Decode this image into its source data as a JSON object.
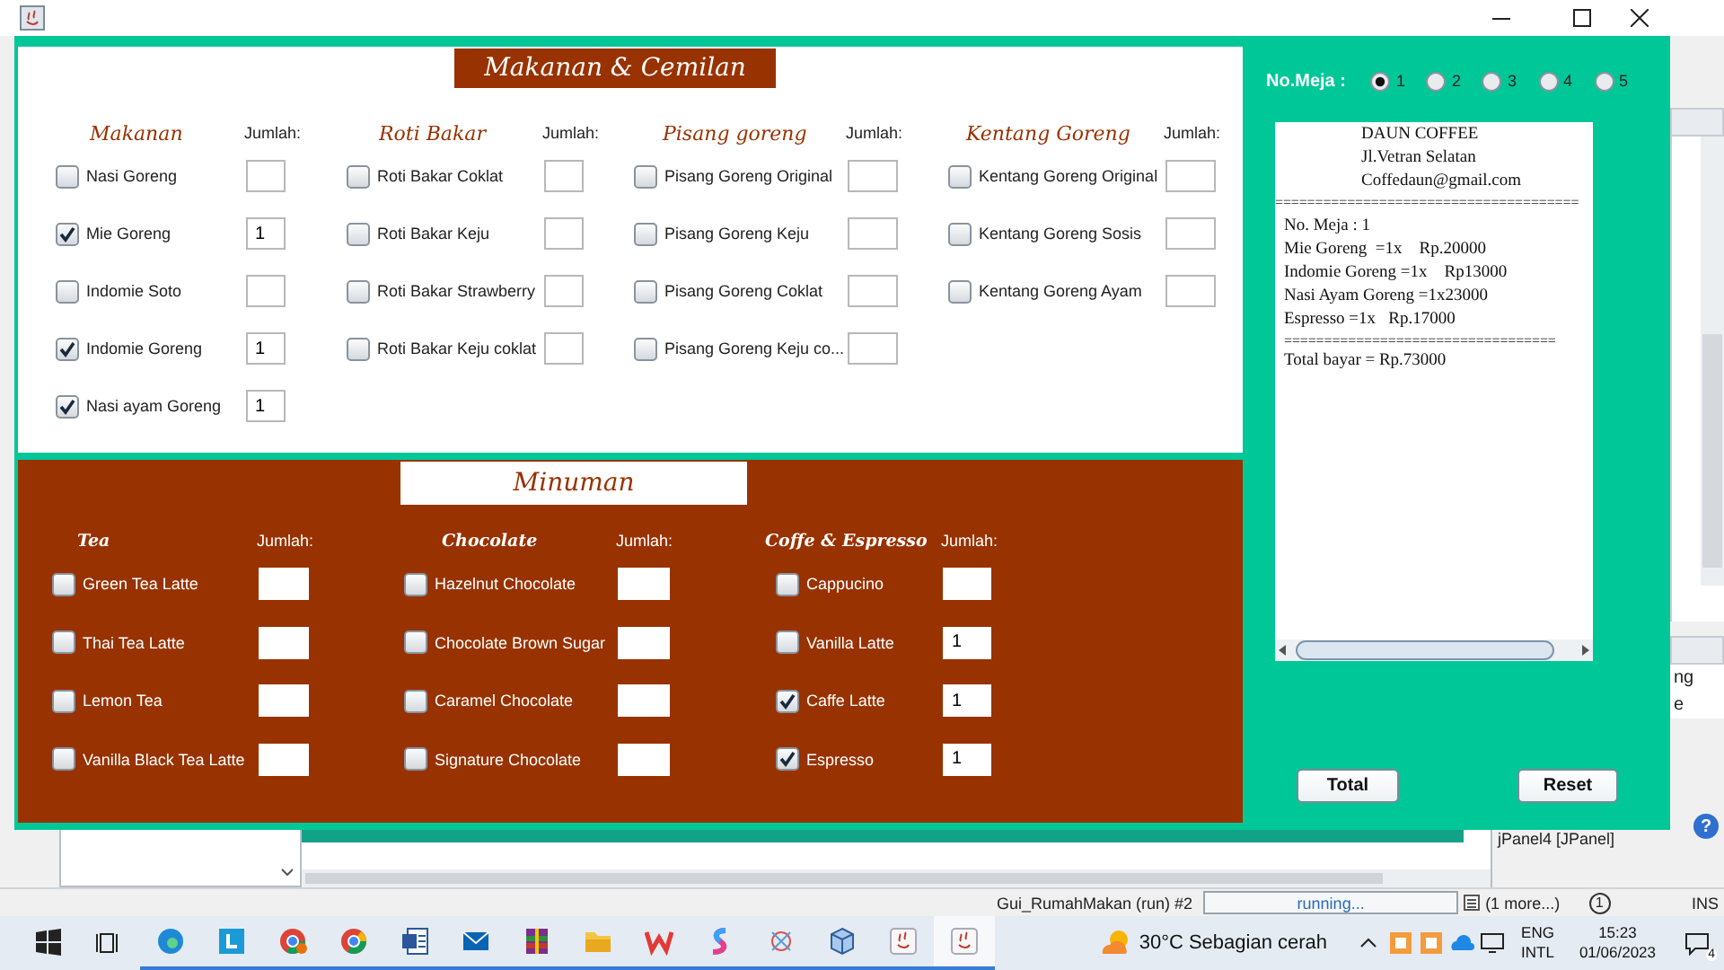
{
  "food_panel": {
    "title": "Makanan & Cemilan",
    "columns": [
      {
        "heading": "Makanan",
        "qty_label": "Jumlah:",
        "items": [
          {
            "label": "Nasi Goreng",
            "checked": false
          },
          {
            "label": "Mie Goreng",
            "checked": true,
            "qty": "1"
          },
          {
            "label": "Indomie Soto",
            "checked": false
          },
          {
            "label": "Indomie Goreng",
            "checked": true,
            "qty": "1"
          },
          {
            "label": "Nasi ayam Goreng",
            "checked": true,
            "qty": "1"
          }
        ]
      },
      {
        "heading": "Roti Bakar",
        "qty_label": "Jumlah:",
        "items": [
          {
            "label": "Roti Bakar Coklat",
            "checked": false
          },
          {
            "label": "Roti Bakar Keju",
            "checked": false
          },
          {
            "label": "Roti Bakar Strawberry",
            "checked": false
          },
          {
            "label": "Roti Bakar Keju coklat",
            "checked": false
          }
        ]
      },
      {
        "heading": "Pisang goreng",
        "qty_label": "Jumlah:",
        "items": [
          {
            "label": "Pisang Goreng Original",
            "checked": false
          },
          {
            "label": "Pisang Goreng Keju",
            "checked": false
          },
          {
            "label": "Pisang Goreng Coklat",
            "checked": false
          },
          {
            "label": "Pisang Goreng Keju co...",
            "checked": false
          }
        ]
      },
      {
        "heading": "Kentang Goreng",
        "qty_label": "Jumlah:",
        "items": [
          {
            "label": "Kentang Goreng Original",
            "checked": false
          },
          {
            "label": "Kentang Goreng Sosis",
            "checked": false
          },
          {
            "label": "Kentang Goreng Ayam",
            "checked": false
          }
        ]
      }
    ]
  },
  "drink_panel": {
    "title": "Minuman",
    "columns": [
      {
        "heading": "Tea",
        "qty_label": "Jumlah:",
        "items": [
          {
            "label": "Green Tea Latte",
            "checked": false
          },
          {
            "label": "Thai Tea Latte",
            "checked": false
          },
          {
            "label": "Lemon Tea",
            "checked": false
          },
          {
            "label": "Vanilla Black Tea Latte",
            "checked": false
          }
        ]
      },
      {
        "heading": "Chocolate",
        "qty_label": "Jumlah:",
        "items": [
          {
            "label": "Hazelnut Chocolate",
            "checked": false
          },
          {
            "label": "Chocolate Brown Sugar",
            "checked": false
          },
          {
            "label": "Caramel Chocolate",
            "checked": false
          },
          {
            "label": "Signature Chocolate",
            "checked": false
          }
        ]
      },
      {
        "heading": "Coffe & Espresso",
        "qty_label": "Jumlah:",
        "items": [
          {
            "label": "Cappucino",
            "checked": false
          },
          {
            "label": "Vanilla Latte",
            "checked": false,
            "qty": "1"
          },
          {
            "label": "Caffe Latte",
            "checked": true,
            "qty": "1"
          },
          {
            "label": "Espresso",
            "checked": true,
            "qty": "1"
          }
        ]
      }
    ]
  },
  "table_number": {
    "label": "No.Meja :",
    "options": [
      {
        "label": "1",
        "selected": true
      },
      {
        "label": "2",
        "selected": false
      },
      {
        "label": "3",
        "selected": false
      },
      {
        "label": "4",
        "selected": false
      },
      {
        "label": "5",
        "selected": false
      }
    ]
  },
  "receipt": {
    "header": [
      "DAUN COFFEE",
      "Jl.Vetran Selatan",
      "Coffedaun@gmail.com"
    ],
    "separator": "======================================",
    "lines": [
      "No. Meja : 1",
      "Mie Goreng  =1x    Rp.20000",
      "Indomie Goreng =1x    Rp13000",
      "Nasi Ayam Goreng =1x23000",
      "Espresso =1x   Rp.17000"
    ],
    "separator_2": "==================================",
    "total": "Total bayar = Rp.73000"
  },
  "buttons": [
    {
      "label": "Total"
    },
    {
      "label": "Reset"
    }
  ],
  "ide": {
    "fragments": [
      "ng",
      "e"
    ],
    "inspector": "jPanel4 [JPanel]",
    "help": "?",
    "status": "Gui_RumahMakan (run) #2",
    "progress": "running...",
    "tasks": "(1 more...)",
    "notifications": "1",
    "mode": "INS"
  },
  "taskbar": {
    "weather": "30°C Sebagian cerah",
    "language": [
      "ENG",
      "INTL"
    ],
    "time": "15:23",
    "date": "01/06/2023",
    "notification_count": "4"
  }
}
